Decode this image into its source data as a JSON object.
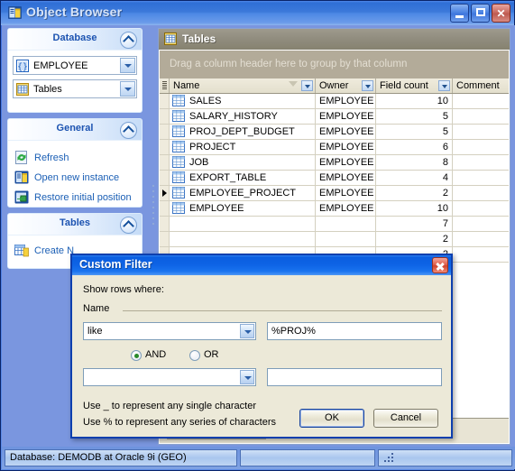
{
  "window": {
    "title": "Object Browser",
    "icon": "object-browser-icon",
    "buttons": {
      "minimize": "Minimize",
      "maximize": "Maximize",
      "close": "Close"
    }
  },
  "sidebar": {
    "groups": [
      {
        "title": "Database",
        "collapse_icon": "chevron-up-icon",
        "combos": [
          {
            "name": "schema",
            "icon": "schema-icon",
            "value": "EMPLOYEE"
          },
          {
            "name": "object-type",
            "icon": "table-icon",
            "value": "Tables"
          }
        ]
      },
      {
        "title": "General",
        "collapse_icon": "chevron-up-icon",
        "links": [
          {
            "icon": "refresh-icon",
            "label": "Refresh"
          },
          {
            "icon": "new-instance-icon",
            "label": "Open new instance"
          },
          {
            "icon": "restore-position-icon",
            "label": "Restore initial position"
          }
        ]
      },
      {
        "title": "Tables",
        "collapse_icon": "chevron-up-icon",
        "links": [
          {
            "icon": "create-table-icon",
            "label": "Create N"
          }
        ]
      }
    ]
  },
  "grid": {
    "caption": "Tables",
    "caption_icon": "table-icon",
    "group_hint": "Drag a column header here to group by that column",
    "columns": [
      {
        "key": "name",
        "label": "Name",
        "sorted": true,
        "filter": true
      },
      {
        "key": "owner",
        "label": "Owner",
        "sorted": false,
        "filter": true
      },
      {
        "key": "fieldcount",
        "label": "Field count",
        "sorted": false,
        "filter": true
      },
      {
        "key": "comment",
        "label": "Comment",
        "sorted": false,
        "filter": false
      }
    ],
    "rows": [
      {
        "name": "SALES",
        "owner": "EMPLOYEE",
        "fieldcount": "10",
        "comment": "",
        "current": false
      },
      {
        "name": "SALARY_HISTORY",
        "owner": "EMPLOYEE",
        "fieldcount": "5",
        "comment": "",
        "current": false
      },
      {
        "name": "PROJ_DEPT_BUDGET",
        "owner": "EMPLOYEE",
        "fieldcount": "5",
        "comment": "",
        "current": false
      },
      {
        "name": "PROJECT",
        "owner": "EMPLOYEE",
        "fieldcount": "6",
        "comment": "",
        "current": false
      },
      {
        "name": "JOB",
        "owner": "EMPLOYEE",
        "fieldcount": "8",
        "comment": "",
        "current": false
      },
      {
        "name": "EXPORT_TABLE",
        "owner": "EMPLOYEE",
        "fieldcount": "4",
        "comment": "",
        "current": false
      },
      {
        "name": "EMPLOYEE_PROJECT",
        "owner": "EMPLOYEE",
        "fieldcount": "2",
        "comment": "",
        "current": true
      },
      {
        "name": "EMPLOYEE",
        "owner": "EMPLOYEE",
        "fieldcount": "10",
        "comment": "",
        "current": false
      },
      {
        "name": "",
        "owner": "",
        "fieldcount": "7",
        "comment": "",
        "current": false
      },
      {
        "name": "",
        "owner": "",
        "fieldcount": "2",
        "comment": "",
        "current": false
      },
      {
        "name": "",
        "owner": "",
        "fieldcount": "2",
        "comment": "",
        "current": false
      }
    ],
    "row_count": "11"
  },
  "dialog": {
    "title": "Custom Filter",
    "close_icon": "close-icon",
    "prompt": "Show rows where:",
    "field_label": "Name",
    "condition1": {
      "operator": "like",
      "value": "%PROJ%"
    },
    "conjunction": {
      "and_label": "AND",
      "or_label": "OR",
      "selected": "AND"
    },
    "condition2": {
      "operator": "",
      "value": ""
    },
    "hints": [
      "Use _ to represent any single character",
      "Use % to represent any series of characters"
    ],
    "ok_label": "OK",
    "cancel_label": "Cancel"
  },
  "statusbar": {
    "panes": [
      "Database: DEMODB  at Oracle 9i (GEO)",
      "",
      ""
    ]
  },
  "colors": {
    "window_blue": "#4d84e3",
    "dialog_title_blue": "#0e64e6",
    "grid_caption_gray": "#908c7e",
    "link_blue": "#1b5fb5",
    "group_bar": "#b3ab99"
  }
}
